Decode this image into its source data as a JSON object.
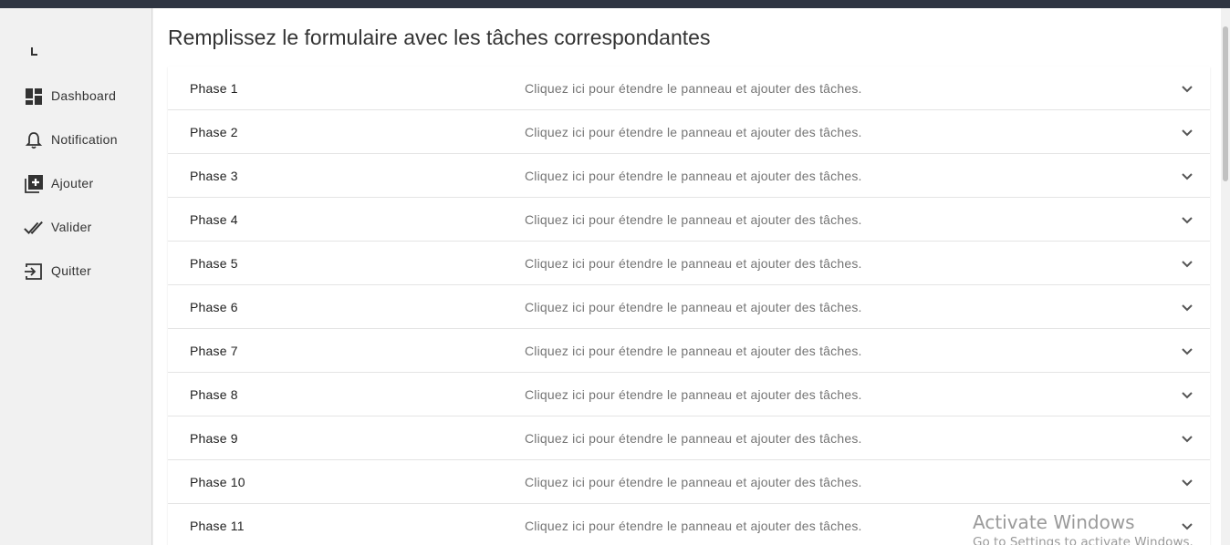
{
  "sidebar": {
    "logo_text": "L",
    "items": [
      {
        "label": "Dashboard",
        "icon": "dashboard-icon"
      },
      {
        "label": "Notification",
        "icon": "bell-icon"
      },
      {
        "label": "Ajouter",
        "icon": "add-box-icon"
      },
      {
        "label": "Valider",
        "icon": "double-check-icon"
      },
      {
        "label": "Quitter",
        "icon": "exit-icon"
      }
    ]
  },
  "main": {
    "title": "Remplissez le formulaire avec les tâches correspondantes",
    "panels": [
      {
        "title": "Phase 1",
        "description": "Cliquez ici pour étendre le panneau et ajouter des tâches."
      },
      {
        "title": "Phase 2",
        "description": "Cliquez ici pour étendre le panneau et ajouter des tâches."
      },
      {
        "title": "Phase 3",
        "description": "Cliquez ici pour étendre le panneau et ajouter des tâches."
      },
      {
        "title": "Phase 4",
        "description": "Cliquez ici pour étendre le panneau et ajouter des tâches."
      },
      {
        "title": "Phase 5",
        "description": "Cliquez ici pour étendre le panneau et ajouter des tâches."
      },
      {
        "title": "Phase 6",
        "description": "Cliquez ici pour étendre le panneau et ajouter des tâches."
      },
      {
        "title": "Phase 7",
        "description": "Cliquez ici pour étendre le panneau et ajouter des tâches."
      },
      {
        "title": "Phase 8",
        "description": "Cliquez ici pour étendre le panneau et ajouter des tâches."
      },
      {
        "title": "Phase 9",
        "description": "Cliquez ici pour étendre le panneau et ajouter des tâches."
      },
      {
        "title": "Phase 10",
        "description": "Cliquez ici pour étendre le panneau et ajouter des tâches."
      },
      {
        "title": "Phase 11",
        "description": "Cliquez ici pour étendre le panneau et ajouter des tâches."
      }
    ]
  },
  "watermark": {
    "title": "Activate Windows",
    "subtitle": "Go to Settings to activate Windows."
  },
  "colors": {
    "topbar": "#2f3542",
    "sidebar_bg": "#f1f1f1",
    "description_text": "#757575"
  }
}
